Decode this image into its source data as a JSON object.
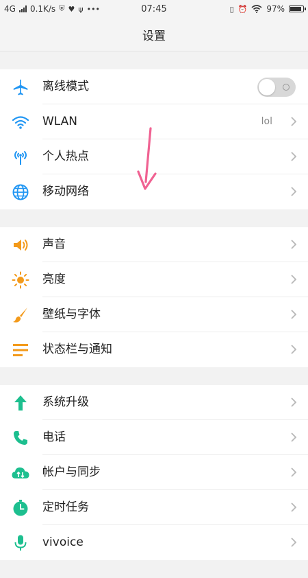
{
  "status_bar": {
    "network": "4G",
    "speed": "0.1K/s",
    "time": "07:45",
    "battery": "97%",
    "battery_level": 0.97
  },
  "header": {
    "title": "设置"
  },
  "colors": {
    "blue": "#2196f3",
    "orange": "#f39a1b",
    "green": "#1dbf8f",
    "chevron": "#b8b8b8",
    "annotation_arrow": "#f06292"
  },
  "groups": [
    {
      "items": [
        {
          "label": "离线模式",
          "icon": "airplane-icon",
          "control": "toggle",
          "toggle_on": false
        },
        {
          "label": "WLAN",
          "icon": "wifi-icon",
          "value": "lol",
          "control": "chevron"
        },
        {
          "label": "个人热点",
          "icon": "hotspot-icon",
          "control": "chevron"
        },
        {
          "label": "移动网络",
          "icon": "globe-icon",
          "control": "chevron"
        }
      ]
    },
    {
      "items": [
        {
          "label": "声音",
          "icon": "speaker-icon",
          "control": "chevron"
        },
        {
          "label": "亮度",
          "icon": "sun-icon",
          "control": "chevron"
        },
        {
          "label": "壁纸与字体",
          "icon": "brush-icon",
          "control": "chevron"
        },
        {
          "label": "状态栏与通知",
          "icon": "list-icon",
          "control": "chevron"
        }
      ]
    },
    {
      "items": [
        {
          "label": "系统升级",
          "icon": "upgrade-arrow-icon",
          "control": "chevron"
        },
        {
          "label": "电话",
          "icon": "phone-icon",
          "control": "chevron"
        },
        {
          "label": "帐户与同步",
          "icon": "cloud-sync-icon",
          "control": "chevron"
        },
        {
          "label": "定时任务",
          "icon": "timer-icon",
          "control": "chevron"
        },
        {
          "label": "vivoice",
          "icon": "microphone-icon",
          "control": "chevron"
        }
      ]
    }
  ]
}
